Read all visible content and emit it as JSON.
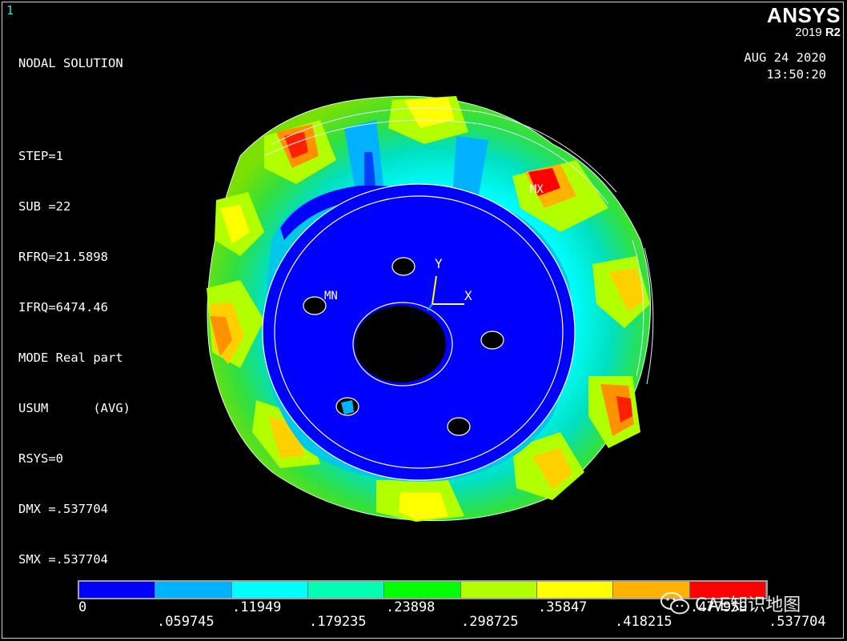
{
  "window_number": "1",
  "info_lines": {
    "title": "NODAL SOLUTION",
    "step": "STEP=1",
    "sub": "SUB =22",
    "rfrq": "RFRQ=21.5898",
    "ifrq": "IFRQ=6474.46",
    "mode": "MODE Real part",
    "usum": "USUM      (AVG)",
    "rsys": "RSYS=0",
    "dmx": "DMX =.537704",
    "smx": "SMX =.537704"
  },
  "logo": {
    "brand": "ANSYS",
    "year": "2019",
    "release": "R2"
  },
  "date": "AUG 24 2020",
  "time": "13:50:20",
  "model_labels": {
    "max": "MX",
    "min": "MN",
    "axis_x": "X",
    "axis_y": "Y"
  },
  "legend": {
    "colors": [
      "#0000ff",
      "#00b2ff",
      "#00ffff",
      "#00ffb2",
      "#00ff00",
      "#b2ff00",
      "#ffff00",
      "#ffb200",
      "#ff0000"
    ],
    "top_ticks": [
      "0",
      ".11949",
      ".23898",
      ".35847",
      ".477959"
    ],
    "bottom_ticks": [
      ".059745",
      ".179235",
      ".298725",
      ".418215",
      ".537704"
    ]
  },
  "watermark": {
    "text": "CAE知识地图",
    "icon": "wechat-icon"
  }
}
